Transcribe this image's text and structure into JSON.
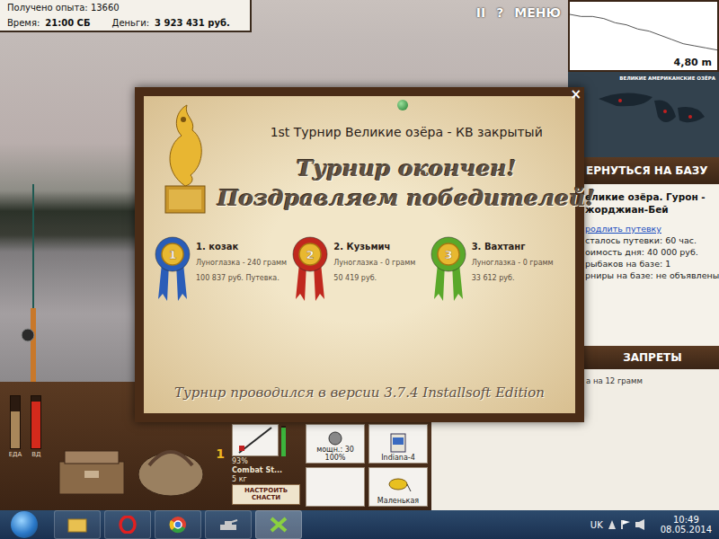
{
  "hud": {
    "experience": "Получено опыта: 13660",
    "time_label": "Время:",
    "time": "21:00 СБ",
    "money_label": "Деньги:",
    "money": "3 923 431 руб."
  },
  "top_menu": [
    "II",
    "?",
    "МЕНЮ"
  ],
  "depth": {
    "reading": "4,80 m",
    "profile": [
      3.1,
      3.2,
      3.2,
      3.3,
      3.5,
      3.6,
      3.8,
      3.9,
      4.1,
      4.3,
      4.5,
      4.6,
      4.7,
      4.8
    ]
  },
  "map": {
    "title": "ВЕЛИКИЕ АМЕРИКАНСКИЕ ОЗЁРА"
  },
  "return_button": "ЕРНУТЬСЯ НА БАЗУ",
  "base_info": {
    "title_lines": [
      "еликие озёра. Гурон -",
      "жорджиан-Бей"
    ],
    "extend_link": "родлить путевку",
    "lines": [
      "сталось путевки: 60 час.",
      "оимость дня: 40 000 руб.",
      "рыбаков на базе: 1",
      "рниры на базе: не объявлены"
    ]
  },
  "bans": {
    "header": "ЗАПРЕТЫ",
    "items": [
      "а на 12 грамм"
    ]
  },
  "needs": [
    {
      "label": "ЕДА",
      "level": 0.7,
      "color": "#a8875a"
    },
    {
      "label": "ВД",
      "level": 0.9,
      "color": "#d42a1c"
    }
  ],
  "slot_number": "1",
  "tackle": {
    "rod": {
      "name": "Combat St...",
      "weight": "5 кг",
      "condition": "93%",
      "level": 0.93
    },
    "reel": {
      "power": "мощн.: 30",
      "condition": "100%"
    },
    "line": "Indiana-4",
    "lure": "Маленькая",
    "setup_button": "НАСТРОИТЬ СНАСТИ"
  },
  "dialog": {
    "title": "1st Турнир Великие озёра - КВ закрытый",
    "close": "×",
    "headline": [
      "Турнир окончен!",
      "Поздравляем победителей!"
    ],
    "winners": [
      {
        "rank": "1",
        "name": "1. козак",
        "catch": "Луноглазка - 240 грамм",
        "prize": "100 837 руб. Путевка.",
        "color": "#2a5db8"
      },
      {
        "rank": "2",
        "name": "2. Кузьмич",
        "catch": "Луноглазка - 0 грамм",
        "prize": "50 419 руб.",
        "color": "#c0281e"
      },
      {
        "rank": "3",
        "name": "3. Вахтанг",
        "catch": "Луноглазка - 0 грамм",
        "prize": "33 612 руб.",
        "color": "#5aa82a"
      }
    ],
    "footer": "Турнир проводился в версии 3.7.4 Installsoft Edition"
  },
  "taskbar": {
    "language": "UK",
    "time": "10:49",
    "date": "08.05.2014"
  }
}
